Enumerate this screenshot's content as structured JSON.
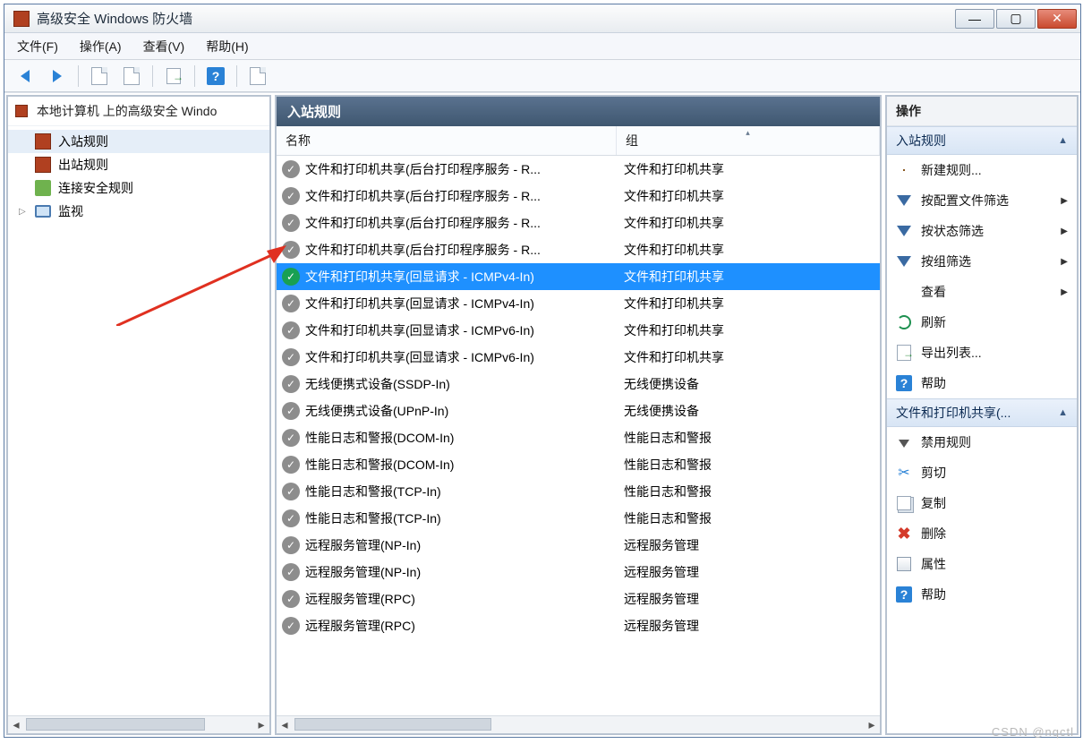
{
  "window": {
    "title": "高级安全 Windows 防火墙"
  },
  "menu": {
    "file": "文件(F)",
    "action": "操作(A)",
    "view": "查看(V)",
    "help": "帮助(H)"
  },
  "left": {
    "root": "本地计算机 上的高级安全 Windo",
    "items": [
      "入站规则",
      "出站规则",
      "连接安全规则",
      "监视"
    ]
  },
  "mid": {
    "title": "入站规则",
    "col_name": "名称",
    "col_group": "组",
    "rows": [
      {
        "enabled": false,
        "name": "文件和打印机共享(后台打印程序服务 - R...",
        "group": "文件和打印机共享"
      },
      {
        "enabled": false,
        "name": "文件和打印机共享(后台打印程序服务 - R...",
        "group": "文件和打印机共享"
      },
      {
        "enabled": false,
        "name": "文件和打印机共享(后台打印程序服务 - R...",
        "group": "文件和打印机共享"
      },
      {
        "enabled": false,
        "name": "文件和打印机共享(后台打印程序服务 - R...",
        "group": "文件和打印机共享"
      },
      {
        "enabled": true,
        "name": "文件和打印机共享(回显请求 - ICMPv4-In)",
        "group": "文件和打印机共享",
        "selected": true
      },
      {
        "enabled": false,
        "name": "文件和打印机共享(回显请求 - ICMPv4-In)",
        "group": "文件和打印机共享"
      },
      {
        "enabled": false,
        "name": "文件和打印机共享(回显请求 - ICMPv6-In)",
        "group": "文件和打印机共享"
      },
      {
        "enabled": false,
        "name": "文件和打印机共享(回显请求 - ICMPv6-In)",
        "group": "文件和打印机共享"
      },
      {
        "enabled": false,
        "name": "无线便携式设备(SSDP-In)",
        "group": "无线便携设备"
      },
      {
        "enabled": false,
        "name": "无线便携式设备(UPnP-In)",
        "group": "无线便携设备"
      },
      {
        "enabled": false,
        "name": "性能日志和警报(DCOM-In)",
        "group": "性能日志和警报"
      },
      {
        "enabled": false,
        "name": "性能日志和警报(DCOM-In)",
        "group": "性能日志和警报"
      },
      {
        "enabled": false,
        "name": "性能日志和警报(TCP-In)",
        "group": "性能日志和警报"
      },
      {
        "enabled": false,
        "name": "性能日志和警报(TCP-In)",
        "group": "性能日志和警报"
      },
      {
        "enabled": false,
        "name": "远程服务管理(NP-In)",
        "group": "远程服务管理"
      },
      {
        "enabled": false,
        "name": "远程服务管理(NP-In)",
        "group": "远程服务管理"
      },
      {
        "enabled": false,
        "name": "远程服务管理(RPC)",
        "group": "远程服务管理"
      },
      {
        "enabled": false,
        "name": "远程服务管理(RPC)",
        "group": "远程服务管理"
      }
    ]
  },
  "right": {
    "title": "操作",
    "sec1": "入站规则",
    "sec2": "文件和打印机共享(...",
    "new_rule": "新建规则...",
    "filter_profile": "按配置文件筛选",
    "filter_state": "按状态筛选",
    "filter_group": "按组筛选",
    "view": "查看",
    "refresh": "刷新",
    "export": "导出列表...",
    "help": "帮助",
    "disable": "禁用规则",
    "cut": "剪切",
    "copy": "复制",
    "delete": "删除",
    "props": "属性"
  },
  "watermark": "CSDN @nqctl"
}
